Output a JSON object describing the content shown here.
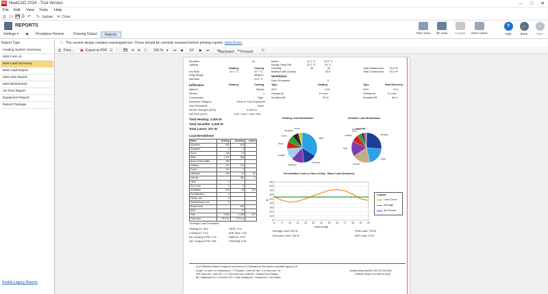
{
  "window": {
    "title": "HeatCAD 2024 - Trial Version",
    "app_icon": "HC"
  },
  "menu": [
    "File",
    "Edit",
    "View",
    "Tools",
    "Help"
  ],
  "quick_access": {
    "update": "Update",
    "close": "Close"
  },
  "ribbon": {
    "section_title": "REPORTS",
    "settings_label": "Settings",
    "tabs": [
      "Floorplans",
      "Review",
      "Drawing Output",
      "Reports"
    ],
    "active_tab": "Reports",
    "right_buttons": [
      {
        "label": "Plan View",
        "icon": "plan-view-icon"
      },
      {
        "label": "3D View",
        "icon": "3d-view-icon"
      },
      {
        "label": "Analysis",
        "icon": "analysis-icon"
      },
      {
        "label": "More Views",
        "icon": "more-views-icon"
      },
      {
        "label": "Help",
        "icon": "help-icon"
      },
      {
        "label": "Back",
        "icon": "back-icon"
      },
      {
        "label": "Next",
        "icon": "next-icon"
      }
    ]
  },
  "warning": {
    "text": "The current design contains warnings/errors. These should be carefully reviewed before printing reports.",
    "link": "View Errors"
  },
  "sidebar": {
    "header": "Report Type",
    "items": [
      "Heating System Summary",
      "MJ8 Form J1",
      "MJ8 Load Summary",
      "MJ8 Load Report",
      "MJ8 AED Report",
      "MJ8 Worksheets",
      "Air Flow Report",
      "Equipment Report",
      "Report Package"
    ],
    "selected_index": 2,
    "legacy_link": "Enable Legacy Reports"
  },
  "viewer_toolbar": {
    "print": "Print...",
    "export_pdf": "Export to PDF",
    "zoom": "100 %",
    "page": "1/2",
    "backward": "Backward",
    "forward": "Forward"
  },
  "report": {
    "top_cut": "Elevation",
    "top_cut_val": "41",
    "design_col_heating": "Heating",
    "design_col_cooling": "Cooling",
    "rows_left": [
      [
        "Latitude",
        "41",
        ""
      ],
      [
        "Dry Bulb",
        "-10.1 °C",
        "31.7 °C"
      ],
      [
        "Daily Range",
        "",
        "Medium"
      ],
      [
        "Wet Bulb",
        "",
        "22.6 °C"
      ]
    ],
    "rows_mid": [
      [
        "Indoor",
        "21.1 °C",
        "23.9 °C"
      ],
      [
        "Design Temp Diff",
        "37.2 °C",
        "7.8 °C"
      ],
      [
        "Humidity",
        "30",
        "50"
      ],
      [
        "Moisture Diff (Grains)",
        "",
        "32.5"
      ]
    ],
    "rows_right": [
      [
        "Total Heated Area",
        "73.0 m²"
      ],
      [
        "Total Cooled Area",
        "73.0 m²"
      ]
    ],
    "ventilation_title": "Ventilation",
    "num_occupants": [
      "Num Occupants",
      "0"
    ],
    "infiltration_title": "Infiltration",
    "infil_cols": [
      "Heating",
      "Cooling"
    ],
    "infil_rows": [
      [
        "Method",
        "Simple"
      ],
      [
        "Stories",
        "1"
      ],
      [
        "Construction",
        "Tight"
      ],
      [
        "Exposure Category",
        "Three or Four Exposures"
      ],
      [
        "Num Fireplaces",
        "None"
      ],
      [
        "Net Air Changes (ACH)",
        "0.23/0.11"
      ],
      [
        "Net Flow (ACH)",
        "5.00 L/min / 2.50 L/min"
      ]
    ],
    "vent_cols": [
      "Type",
      "Heating",
      "Type",
      "Heat Recovery"
    ],
    "vent_rows": [
      [
        "ACH",
        "0.24",
        "ACH",
        "0.24"
      ],
      [
        "Outside Air",
        "0 L/min",
        "Outside Air",
        "0 L/min"
      ],
      [
        "Sensible Eff.",
        "50 %",
        "Sensible Eff.",
        "50 %"
      ]
    ],
    "totals": [
      "Total Heating: 3,300 W",
      "Total Sensible: 2,028 W",
      "Total Latent: 207 W"
    ],
    "load_breakdown_title": "Load Breakdown",
    "load_headers": [
      "Name",
      "Heating",
      "Sensible",
      "Latent"
    ],
    "load_rows": [
      [
        "Windows*",
        "462",
        "483",
        ""
      ],
      [
        "Skylights*",
        "0",
        "0",
        ""
      ],
      [
        "Doors",
        "236",
        "79",
        ""
      ],
      [
        "Walls",
        "1,101",
        "366",
        ""
      ],
      [
        "Below Grade Walls",
        "408",
        "",
        ""
      ],
      [
        "Ceilings",
        "247",
        "144",
        ""
      ],
      [
        "Floors",
        "131",
        "0",
        ""
      ],
      [
        "Infiltration",
        "440",
        "47",
        "60"
      ],
      [
        "Internal",
        "",
        "352",
        "0"
      ],
      [
        "Other",
        "0",
        "",
        ""
      ],
      [
        "Duct Loss",
        "0",
        "0",
        ""
      ],
      [
        "Ventilation",
        "229",
        "48",
        "109"
      ],
      [
        "Humidification",
        "0",
        "",
        ""
      ],
      [
        "Piping Loss",
        "0",
        "",
        ""
      ],
      [
        "Radiant Back Loss",
        "0",
        "",
        ""
      ],
      [
        "Blower Heat",
        "",
        "300",
        ""
      ],
      [
        "AED*",
        "",
        "11",
        ""
      ],
      [
        "Total",
        "3,066",
        "2,028",
        "207"
      ],
      [
        "Total Area",
        "73.0 m²",
        "73.0 m²",
        ""
      ]
    ],
    "footnote_avg": "*Average Load Procedure",
    "bottom_left": [
      [
        "Heating ΔT: 38.9",
        "JSHR: 0.91"
      ],
      [
        "Cooling ΔT: 10.0",
        "MJ8 Tons: 0.64"
      ],
      [
        "Est. Heating CFM*: 178",
        "Sqft/Ton: 1237"
      ],
      [
        "Est. Cooling CFM*: 356",
        "CFM/Sqft: 0.45"
      ]
    ],
    "pie1_title": "Heating Load Breakdown",
    "pie2_title": "Sensible Load Breakdown",
    "pie_labels_left": [
      "Walls",
      "Ceilings",
      "Floors",
      "Doors",
      "Infiltration",
      "Ventilation"
    ],
    "pie_labels_right": [
      "Windows",
      "Below Grade",
      "Infiltration",
      "Ventilation",
      "Internal",
      "Blower Heat"
    ],
    "line_title": "Fenestration Load vs Hour of Day - Block Load (Summer)",
    "avg_load": "Average Load: 544 W",
    "excursion_limit": "Excursion Limit: 706 W",
    "peak_load": "Peak Load: 718 W",
    "aed_load": "AED Load: 11 W",
    "footer_notes": [
      "(*) all: Difference between supply air and return air   (†) Estimated air flow based on specified supply air ΔT",
      "Length = m  Area = m²  Temperature = °C  Flowrate = L/min  Air Flow = L/s  Heat Loss = W",
      "UHF Heat Loss = W/m²  RV = m² °C/W  Heat Loss = kWh  RH = Radiant Floor Heating",
      "BB = Baseboard  FA = Forced Air  OTH = Other Heating  SM = Snowmelt  N = Not Heated"
    ],
    "footer_right": [
      "Created Using HeatCAD 2024 (11.06.2025)",
      "Software Version 24.0.0620.M (Trial)"
    ]
  },
  "chart_data": [
    {
      "type": "pie",
      "title": "Heating Load Breakdown",
      "categories": [
        "Walls",
        "Windows",
        "Infiltration",
        "Below Grade Walls",
        "Ceilings",
        "Doors",
        "Ventilation",
        "Floors"
      ],
      "values": [
        1101,
        462,
        440,
        408,
        247,
        236,
        229,
        131
      ],
      "colors": [
        "#29a3e6",
        "#1b3e9b",
        "#7b3fb0",
        "#a0d2ea",
        "#d92020",
        "#2aa12a",
        "#2a2a2a",
        "#f0c419"
      ]
    },
    {
      "type": "pie",
      "title": "Sensible Load Breakdown",
      "categories": [
        "Windows",
        "Walls",
        "Internal",
        "Blower Heat",
        "Ceilings",
        "Doors",
        "Ventilation",
        "Infiltration",
        "AED"
      ],
      "values": [
        483,
        366,
        352,
        300,
        144,
        79,
        48,
        47,
        11
      ],
      "colors": [
        "#1b3e9b",
        "#29a3e6",
        "#c8ab86",
        "#7b3fb0",
        "#d92020",
        "#2aa12a",
        "#2a2a2a",
        "#b03fb0",
        "#f0c419"
      ]
    },
    {
      "type": "line",
      "title": "Fenestration Load vs Hour of Day - Block Load (Summer)",
      "xlabel": "Hour of Day",
      "ylabel": "W",
      "x": [
        8,
        9,
        10,
        11,
        12,
        13,
        14,
        15,
        16,
        17,
        18,
        19,
        20
      ],
      "xlim": [
        8,
        20
      ],
      "ylim": [
        0,
        900
      ],
      "yticks": [
        0,
        100,
        200,
        300,
        400,
        500,
        600,
        700,
        800,
        900
      ],
      "legend_title": "Legend",
      "legend_position": "right",
      "series": [
        {
          "name": "Load Curve",
          "color": "#f08a1c",
          "values": [
            560,
            465,
            425,
            445,
            500,
            575,
            640,
            700,
            718,
            690,
            610,
            500,
            465
          ]
        },
        {
          "name": "Average",
          "color": "#2a9a2a",
          "values": [
            544,
            544,
            544,
            544,
            544,
            544,
            544,
            544,
            544,
            544,
            544,
            544,
            544
          ]
        },
        {
          "name": "30 Percent",
          "color": "#2a3fd6",
          "values": []
        }
      ]
    }
  ]
}
